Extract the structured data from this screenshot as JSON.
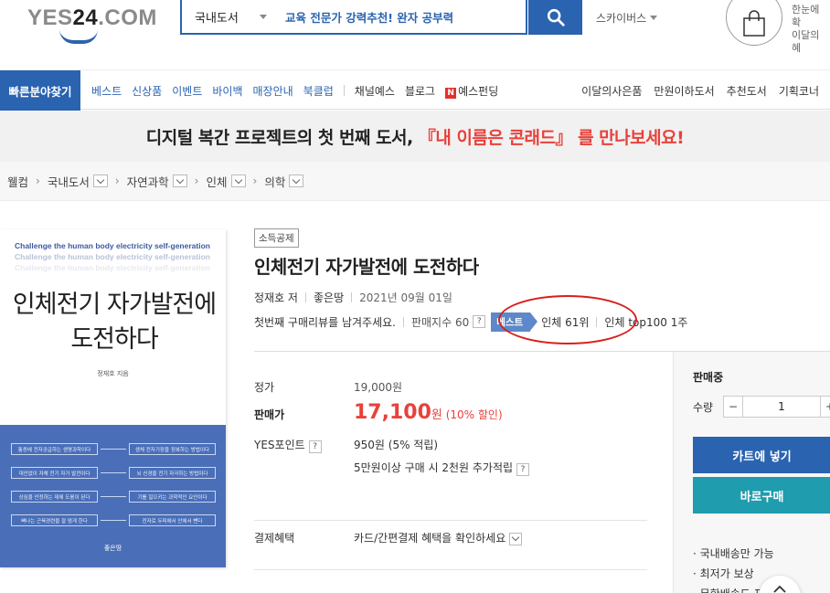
{
  "header": {
    "logo_prefix": "YES",
    "logo_number": "24",
    "logo_suffix": ".COM",
    "search_category": "국내도서",
    "search_value": "교육 전문가 강력추천! 완자 공부력",
    "skyibus": "스카이버스",
    "side_promo_line1": "한눈에 확",
    "side_promo_line2": "이달의 혜"
  },
  "nav": {
    "quick_category": "빠른분야찾기",
    "left_blue": [
      "베스트",
      "신상품",
      "이벤트",
      "바이백",
      "매장안내",
      "북클럽"
    ],
    "left_dark": [
      "채널예스",
      "블로그"
    ],
    "yes_funding_badge": "N",
    "yes_funding": "예스펀딩",
    "right": [
      "이달의사은품",
      "만원이하도서",
      "추천도서",
      "기획코너"
    ]
  },
  "banner": {
    "text_before": "디지털 복간 프로젝트의 첫 번째 도서, ",
    "text_highlight": "『내 이름은 콘래드』",
    "text_after": " 를 만나보세요!"
  },
  "breadcrumb": [
    "웰컴",
    "국내도서",
    "자연과학",
    "인체",
    "의학"
  ],
  "cover": {
    "english_title": "Challenge the human body electricity self-generation",
    "title_line1": "인체전기 자가발전에",
    "title_line2": "도전하다",
    "author": "정재호 지음",
    "publisher": "좋은땅",
    "boxes": [
      [
        "통증에 전자공급하는 생명과학이다",
        "생체 전자기장을 정복하는 방법이다"
      ],
      [
        "대안없이 자체 전기 자가 발전이다",
        "뇌 신경을 전기 자극하는 방법이다"
      ],
      [
        "상심을 안정하는 데에 도움이 된다",
        "기를 일으키는 과학적인 요인이다"
      ],
      [
        "뼈나는 근육경련을 잘 멈게 한다",
        "전자로 두피에서 안에서 뺀다"
      ]
    ]
  },
  "product": {
    "tax_badge": "소득공제",
    "title": "인체전기 자가발전에 도전하다",
    "author": "정재호 저",
    "publisher": "좋은땅",
    "date": "2021년 09월 01일",
    "review_prompt": "첫번째 구매리뷰를 남겨주세요.",
    "sales_index": "판매지수 60",
    "best_tag": "베스트",
    "rank1": "인체 61위",
    "rank2": "인체 top100 1주",
    "question_mark": "?"
  },
  "price": {
    "list_label": "정가",
    "list_price": "19,000원",
    "sale_label": "판매가",
    "sale_price": "17,100",
    "sale_unit": "원",
    "discount": "(10% 할인)",
    "point_label": "YES포인트",
    "point_value": "950원 (5% 적립)",
    "extra_point": "5만원이상 구매 시 2천원 추가적립",
    "benefit_label": "결제혜택",
    "benefit_value": "카드/간편결제 혜택을 확인하세요"
  },
  "panel": {
    "status": "판매중",
    "qty_label": "수량",
    "qty_minus": "−",
    "qty_value": "1",
    "qty_plus": "+",
    "cart": "카트에 넣기",
    "buy": "바로구매",
    "perks": [
      "· 국내배송만 가능",
      "· 최저가 보상",
      "· 무한배송도 포"
    ]
  },
  "colors": {
    "brand_blue": "#2a63b0",
    "sale_red": "#e8413c",
    "buy_teal": "#1f9cae"
  }
}
